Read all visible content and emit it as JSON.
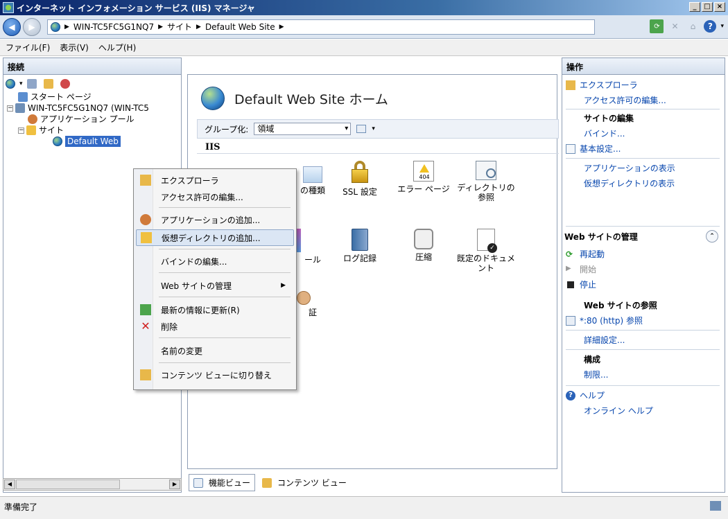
{
  "window": {
    "title": "インターネット インフォメーション サービス (IIS) マネージャ"
  },
  "address": {
    "crumbs": [
      "WIN-TC5FC5G1NQ7",
      "サイト",
      "Default Web Site"
    ]
  },
  "menu": {
    "items": [
      "ファイル(F)",
      "表示(V)",
      "ヘルプ(H)"
    ]
  },
  "connections": {
    "header": "接続",
    "tree": [
      "スタート ページ",
      "WIN-TC5FC5G1NQ7 (WIN-TC5",
      "アプリケーション プール",
      "サイト",
      "Default Web"
    ]
  },
  "center": {
    "title": "Default Web Site ホーム",
    "group_label": "グループ化:",
    "group_value": "領域",
    "section": "IIS",
    "features": [
      "の種類",
      "SSL 設定",
      "エラー ページ",
      "ディレクトリの参照",
      "ール",
      "ログ記録",
      "圧縮",
      "既定のドキュメント",
      "証"
    ]
  },
  "bottom_tabs": {
    "features": "機能ビュー",
    "content": "コンテンツ ビュー"
  },
  "context_menu": {
    "items": [
      "エクスプローラ",
      "アクセス許可の編集...",
      "アプリケーションの追加...",
      "仮想ディレクトリの追加...",
      "バインドの編集...",
      "Web サイトの管理",
      "最新の情報に更新(R)",
      "削除",
      "名前の変更",
      "コンテンツ ビューに切り替え"
    ]
  },
  "actions": {
    "header": "操作",
    "explore": "エクスプローラ",
    "edit_permissions": "アクセス許可の編集...",
    "edit_site_title": "サイトの編集",
    "bindings": "バインド...",
    "basic_settings": "基本設定...",
    "view_applications": "アプリケーションの表示",
    "view_vdirs": "仮想ディレクトリの表示",
    "manage_title": "Web サイトの管理",
    "restart": "再起動",
    "start": "開始",
    "stop": "停止",
    "browse_title": "Web サイトの参照",
    "browse_80": "*:80 (http) 参照",
    "advanced": "詳細設定...",
    "configure_title": "構成",
    "limits": "制限...",
    "help": "ヘルプ",
    "online_help": "オンライン ヘルプ"
  },
  "status": {
    "text": "準備完了"
  }
}
